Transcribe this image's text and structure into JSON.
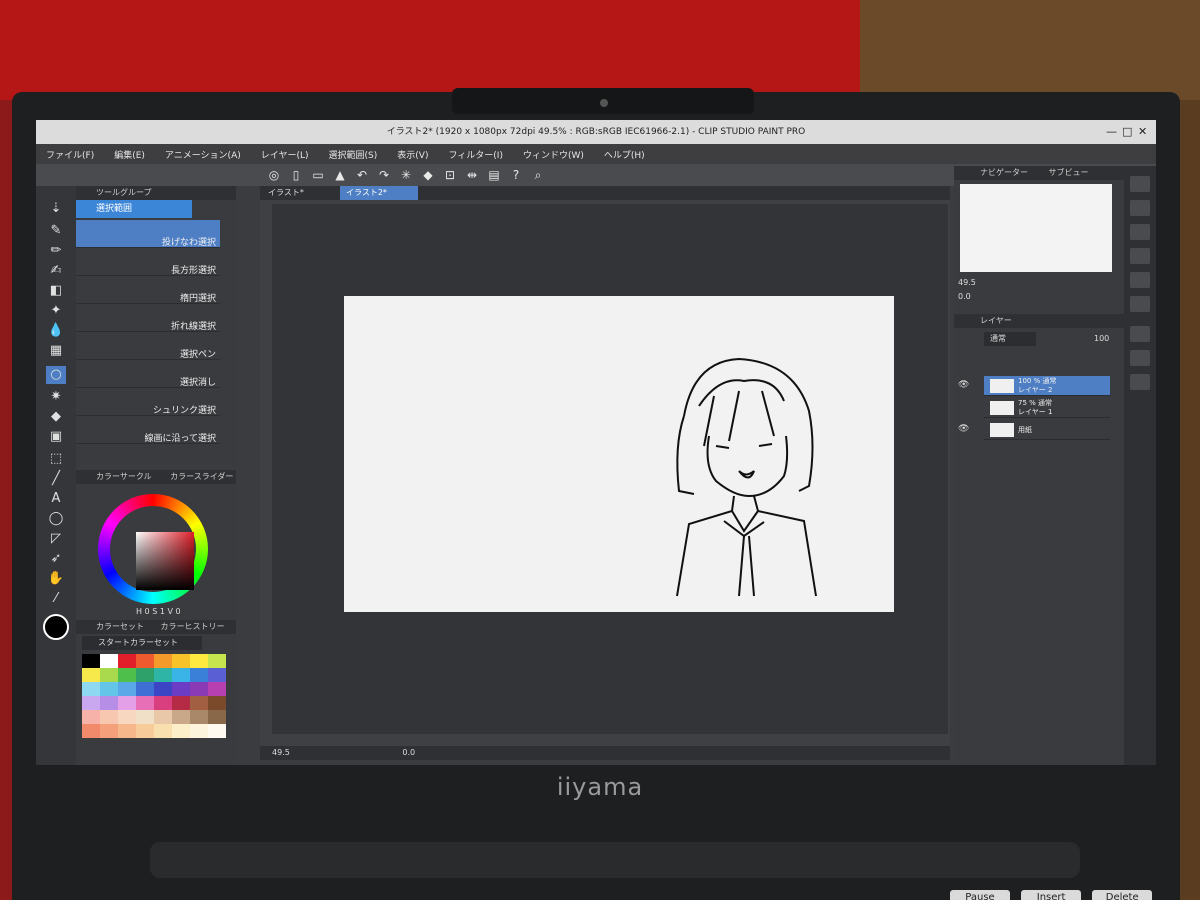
{
  "window": {
    "title": "イラスト2* (1920 x 1080px 72dpi 49.5% : RGB:sRGB IEC61966-2.1) - CLIP STUDIO PAINT PRO"
  },
  "menu": [
    "ファイル(F)",
    "編集(E)",
    "アニメーション(A)",
    "レイヤー(L)",
    "選択範囲(S)",
    "表示(V)",
    "フィルター(I)",
    "ウィンドウ(W)",
    "ヘルプ(H)"
  ],
  "subtool": {
    "group_tab": "ツールグループ",
    "active_group": "選択範囲",
    "items": [
      {
        "label": "投げなわ選択",
        "selected": true
      },
      {
        "label": "長方形選択"
      },
      {
        "label": "楕円選択"
      },
      {
        "label": "折れ線選択"
      },
      {
        "label": "選択ペン"
      },
      {
        "label": "選択消し"
      },
      {
        "label": "シュリンク選択"
      },
      {
        "label": "線画に沿って選択"
      }
    ]
  },
  "color": {
    "tab_circle": "カラーサークル",
    "tab_slider": "カラースライダー",
    "values": "H 0 S 1 V 0"
  },
  "colorset": {
    "tab_set": "カラーセット",
    "tab_history": "カラーヒストリー",
    "selected": "スタートカラーセット",
    "swatches": [
      "#000000",
      "#ffffff",
      "#e01f2a",
      "#ef5b2f",
      "#f49a2a",
      "#f7c22a",
      "#fde93f",
      "#c6e44d",
      "#f7e84b",
      "#a9d94d",
      "#4fbf4b",
      "#2ea06a",
      "#2fb5a5",
      "#3ab3e6",
      "#3a7fd8",
      "#5a5fd4",
      "#8fd8f2",
      "#63c5e8",
      "#5aa8e8",
      "#3d6fd4",
      "#3c45c4",
      "#6c3cc4",
      "#8a3ab5",
      "#b640b0",
      "#c9a8f0",
      "#b68ee6",
      "#e4a0e6",
      "#e66fb5",
      "#d93e7e",
      "#b52b45",
      "#a35f42",
      "#7a4a2a",
      "#f6b2a8",
      "#f7c7b0",
      "#f7d7c0",
      "#f0e0c8",
      "#e8c8a8",
      "#c8a888",
      "#a88868",
      "#886848",
      "#f08a6a",
      "#f4a07a",
      "#f6b88a",
      "#f8cc9a",
      "#f9dfae",
      "#fbeec8",
      "#fcf4dd",
      "#fffaf0"
    ]
  },
  "tabs": [
    "イラスト*",
    "イラスト2*"
  ],
  "footer": {
    "zoom": "49.5",
    "rotate": "0.0"
  },
  "navigator": {
    "tab_nav": "ナビゲーター",
    "tab_sub": "サブビュー",
    "zoom": "49.5",
    "rotate": "0.0"
  },
  "layers": {
    "tab": "レイヤー",
    "blend": "通常",
    "opacity": "100",
    "items": [
      {
        "line1": "100 % 通常",
        "line2": "レイヤー 2",
        "selected": true
      },
      {
        "line1": "75 % 通常",
        "line2": "レイヤー 1"
      },
      {
        "line1": "用紙",
        "line2": ""
      }
    ]
  },
  "brand": "iiyama",
  "keys": [
    "Pause",
    "Insert",
    "Delete"
  ]
}
